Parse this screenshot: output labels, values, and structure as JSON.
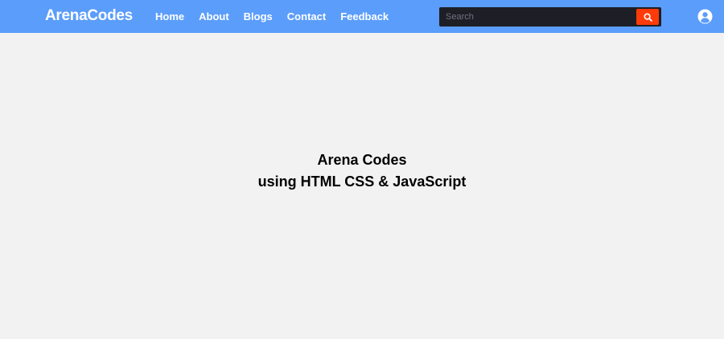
{
  "header": {
    "logo": "ArenaCodes",
    "nav": [
      "Home",
      "About",
      "Blogs",
      "Contact",
      "Feedback"
    ],
    "search": {
      "placeholder": "Search",
      "value": ""
    },
    "search_icon": "search-icon",
    "account_icon": "user-circle-icon"
  },
  "hero": {
    "line1": "Arena Codes",
    "line2": "using HTML CSS & JavaScript"
  },
  "colors": {
    "navbar": "#5b9dfa",
    "background": "#f2f2f2",
    "search_bg": "#1e1f26",
    "search_button": "#ff3b0a"
  }
}
